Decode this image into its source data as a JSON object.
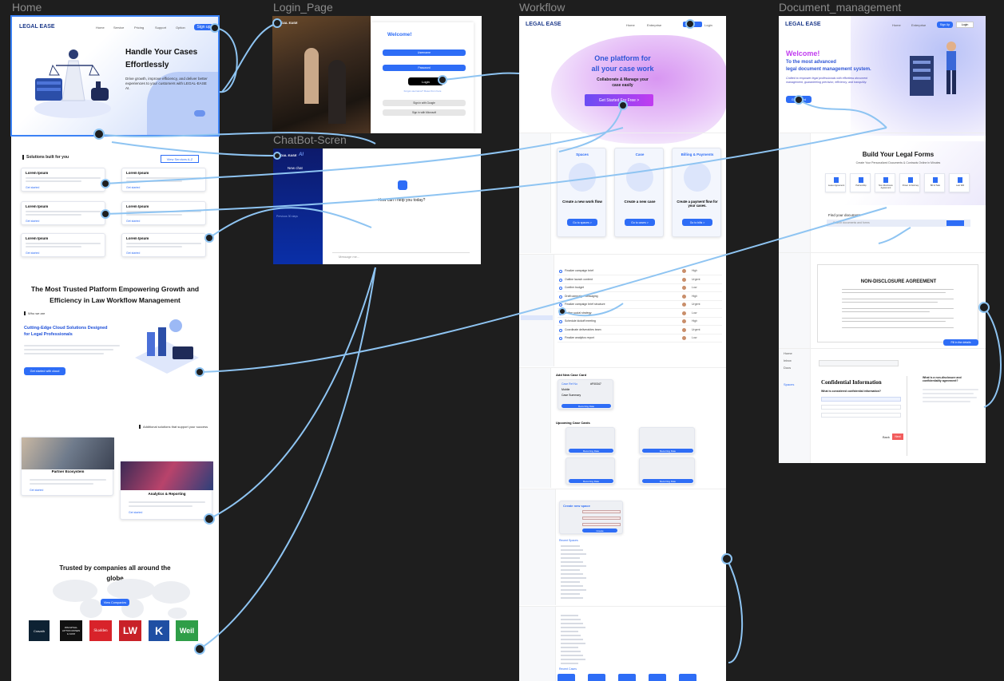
{
  "frames": {
    "home": "Home",
    "login": "Login_Page",
    "workflow": "Workflow",
    "docmgmt": "Document_management",
    "chatbot": "ChatBot-Scren"
  },
  "brand": "LEGAL EASE",
  "home": {
    "nav": [
      "Home",
      "Service",
      "Pricing",
      "Support",
      "Option"
    ],
    "cta": "Sign up",
    "hero_title_1": "Handle Your Cases",
    "hero_title_2": "Effortlessly",
    "hero_text": "Drive growth, improve efficiency, and deliver better experiences to your customers with LEGAL-EASE AI.",
    "solutions_title": "Solutions built for you",
    "view_services": "View Services A-Z",
    "lorem": "Lorem Ipsum",
    "learn_more": "Get started",
    "trusted_heading_1": "The Most Trusted Platform Empowering Growth and",
    "trusted_heading_2": "Efficiency in Law Workflow Management",
    "who_we_are": "Who we are",
    "cloud_title_1": "Cutting-Edge Cloud Solutions Designed",
    "cloud_title_2": "for Legal Professionals",
    "cloud_btn": "Get started with cloud",
    "additional": "Additional solutions that support your success",
    "partner": "Partner Ecosystem",
    "analytics": "Analytics & Reporting",
    "companies_title_1": "Trusted by companies all around the",
    "companies_title_2": "globe",
    "view_companies": "View Companies",
    "logos": [
      "Cravath",
      "WACHTELL LIPTON ROSEN & KATZ",
      "Skadden",
      "LW",
      "K",
      "Weil"
    ]
  },
  "login": {
    "welcome": "Welcome!",
    "username": "Username",
    "password": "Password",
    "login_btn": "Login",
    "forgot": "Forgot username? Reset from here",
    "google": "Sign in with Google",
    "microsoft": "Sign in with Microsoft"
  },
  "chatbot": {
    "brand": "LEGAL EASE",
    "ai": "AI",
    "new_chat": "New chat",
    "previous": "Previous 30 days",
    "prompt": "How can I help you today?",
    "placeholder": "Message me..."
  },
  "workflow": {
    "nav": [
      "Home",
      "Enterprise",
      "Login"
    ],
    "hero_1": "One platform for",
    "hero_2": "all your case work",
    "hero_sub_1": "Collaborate & Manage your",
    "hero_sub_2": "case easily",
    "hero_btn": "Get Started For Free >",
    "cards": [
      {
        "title": "Spaces",
        "text": "Create a new work flow",
        "btn": "Go to spaces >"
      },
      {
        "title": "Case",
        "text": "Create a new case",
        "btn": "Go to cases >"
      },
      {
        "title": "Billing & Payments",
        "text": "Create a payment flow for your cases.",
        "btn": "Go to bills >"
      }
    ],
    "add_case": "Add New Case Card",
    "upcoming": "Upcoming Case Cards",
    "case_ref": "Case Ref No",
    "case_ref_val": "#F00347",
    "mobile": "Mobile",
    "case_summary": "Case Summary",
    "recurring": "Recurring Date",
    "create_space": "Create new space",
    "create_btn": "Create",
    "recent_spaces": "Recent Spaces",
    "recent_cases": "Recent Cases",
    "tasks": [
      "Finalize campaign brief",
      "Outline launch content",
      "Confirm budget",
      "Draft campaign messaging",
      "Finalize campaign brief structure",
      "Define social strategy",
      "Schedule kickoff meeting",
      "Coordinate deliverables team",
      "Finalize analytics report"
    ],
    "priority": [
      "High",
      "Urgent",
      "Low",
      "High",
      "Urgent",
      "Low",
      "High",
      "Urgent",
      "Low"
    ]
  },
  "docmgmt": {
    "nav": [
      "Home",
      "Enterprise",
      "Sign Up",
      "Login"
    ],
    "welcome": "Welcome!",
    "sub_1": "To the most advanced",
    "sub_2": "legal document management system.",
    "desc": "Crafted to empower legal professionals with effortless document management, guaranteeing precision, efficiency, and tranquility.",
    "btn": "Get Started",
    "forms_title": "Build Your Legal Forms",
    "forms_sub": "Create Your Personalized Documents & Contracts Online in Minutes",
    "forms": [
      "Lease Agreement",
      "Partnership",
      "Non-Disclosure Agreement",
      "Power of Attorney",
      "Bill of Sale",
      "Last Will"
    ],
    "find": "Find your document",
    "search_ph": "Search documents and forms",
    "nda": "NON-DISCLOSURE AGREEMENT",
    "fill": "Fill in the details",
    "conf_title": "Confidential Information",
    "question": "What is considered confidential information?",
    "what_is": "What is a non-disclosure and confidentiality agreement?",
    "back": "Back",
    "next": "Next",
    "sidebar": [
      "Home",
      "Inbox",
      "Docs",
      "Spaces"
    ]
  },
  "colors": {
    "primary": "#2e6df6",
    "wire": "#8ec4f2",
    "canvas": "#1e1e1e",
    "brand_navy": "#1d3a8a",
    "accent_pink": "#c13cf0"
  }
}
